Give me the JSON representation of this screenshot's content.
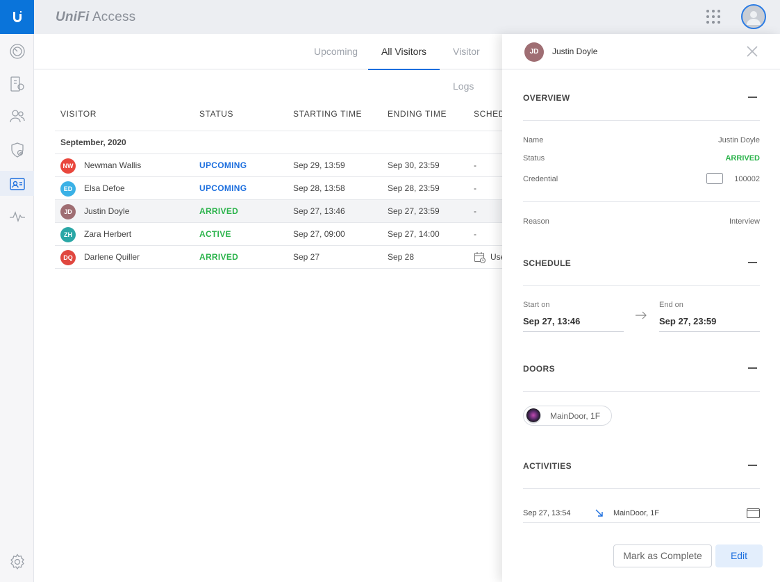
{
  "app": {
    "brand_prefix": "UniFi",
    "brand_suffix": "Access"
  },
  "tabs": [
    {
      "label": "Upcoming",
      "active": false
    },
    {
      "label": "All Visitors",
      "active": true
    },
    {
      "label": "Visitor Logs",
      "active": false
    }
  ],
  "table": {
    "columns": [
      "VISITOR",
      "STATUS",
      "STARTING TIME",
      "ENDING TIME",
      "SCHED"
    ],
    "group_label": "September, 2020",
    "rows": [
      {
        "initials": "NW",
        "avatar_color": "#e9473d",
        "name": "Newman Wallis",
        "status": "UPCOMING",
        "start": "Sep 29, 13:59",
        "end": "Sep 30, 23:59",
        "schedule": "-"
      },
      {
        "initials": "ED",
        "avatar_color": "#3ab1e6",
        "name": "Elsa Defoe",
        "status": "UPCOMING",
        "start": "Sep 28, 13:58",
        "end": "Sep 28, 23:59",
        "schedule": "-"
      },
      {
        "initials": "JD",
        "avatar_color": "#9f6e73",
        "name": "Justin Doyle",
        "status": "ARRIVED",
        "start": "Sep 27, 13:46",
        "end": "Sep 27, 23:59",
        "schedule": "-"
      },
      {
        "initials": "ZH",
        "avatar_color": "#2aa7a6",
        "name": "Zara Herbert",
        "status": "ACTIVE",
        "start": "Sep 27, 09:00",
        "end": "Sep 27, 14:00",
        "schedule": "-"
      },
      {
        "initials": "DQ",
        "avatar_color": "#e0473f",
        "name": "Darlene Quiller",
        "status": "ARRIVED",
        "start": "Sep 27",
        "end": "Sep 28",
        "schedule": "Use"
      }
    ]
  },
  "drawer": {
    "initials": "JD",
    "name": "Justin Doyle",
    "overview": {
      "title": "OVERVIEW",
      "name_label": "Name",
      "name_value": "Justin Doyle",
      "status_label": "Status",
      "status_value": "ARRIVED",
      "credential_label": "Credential",
      "credential_value": "100002",
      "reason_label": "Reason",
      "reason_value": "Interview"
    },
    "schedule": {
      "title": "SCHEDULE",
      "start_label": "Start on",
      "start_value": "Sep 27, 13:46",
      "end_label": "End on",
      "end_value": "Sep 27, 23:59"
    },
    "doors": {
      "title": "DOORS",
      "items": [
        "MainDoor, 1F"
      ]
    },
    "activities": {
      "title": "ACTIVITIES",
      "items": [
        {
          "time": "Sep 27, 13:54",
          "door": "MainDoor, 1F"
        }
      ]
    },
    "buttons": {
      "complete": "Mark as Complete",
      "edit": "Edit"
    }
  },
  "colors": {
    "accent": "#1d6fde",
    "logo_bg": "#0a74da",
    "arrived": "#2bb34b",
    "upcoming": "#1d6fde"
  }
}
